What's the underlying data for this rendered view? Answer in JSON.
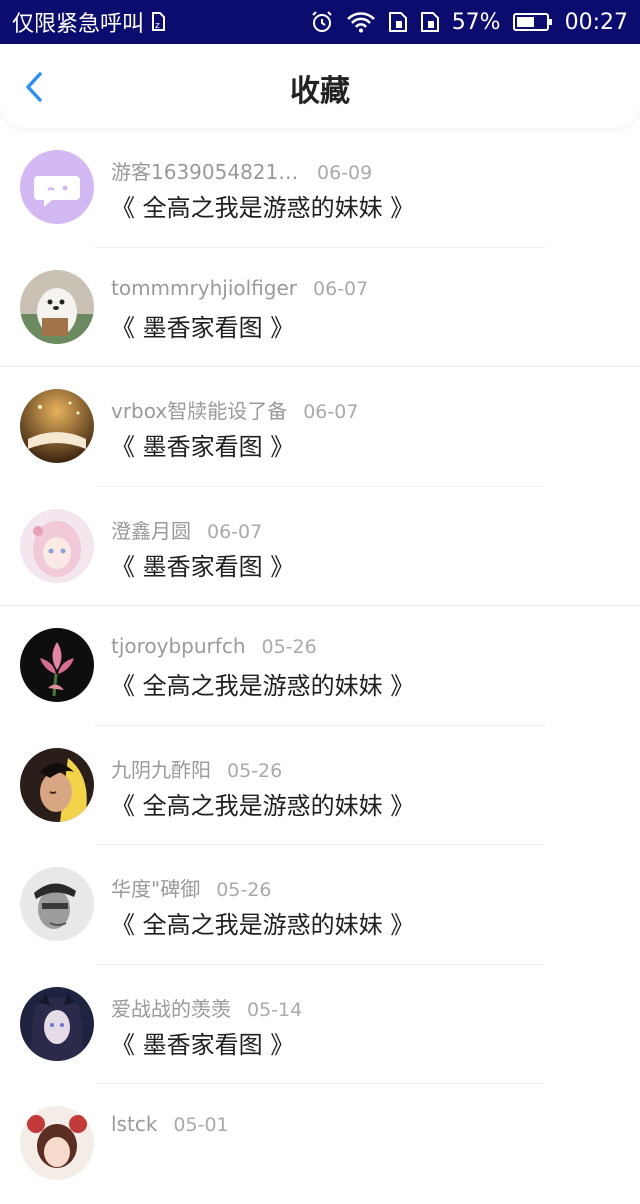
{
  "status_bar": {
    "carrier": "仅限紧急呼叫",
    "battery": "57%",
    "time": "00:27"
  },
  "header": {
    "title": "收藏"
  },
  "items": [
    {
      "name": "游客16390548212...",
      "date": "06-09",
      "book": "《 全高之我是游惑的妹妹 》"
    },
    {
      "name": "tommmryhjiolfiger",
      "date": "06-07",
      "book": "《 墨香家看图 》"
    },
    {
      "name": "vrbox智牍能设了备",
      "date": "06-07",
      "book": "《 墨香家看图 》"
    },
    {
      "name": "澄鑫月圆",
      "date": "06-07",
      "book": "《 墨香家看图 》"
    },
    {
      "name": "tjoroybpurfch",
      "date": "05-26",
      "book": "《 全高之我是游惑的妹妹 》"
    },
    {
      "name": "九阴九酢阳",
      "date": "05-26",
      "book": "《 全高之我是游惑的妹妹 》"
    },
    {
      "name": "华度\"碑御",
      "date": "05-26",
      "book": "《 全高之我是游惑的妹妹 》"
    },
    {
      "name": "爱战战的羡羡",
      "date": "05-14",
      "book": "《 墨香家看图 》"
    },
    {
      "name": "lstck",
      "date": "05-01",
      "book": ""
    }
  ],
  "colors": {
    "status_bar_bg": "#0c0c6e",
    "accent": "#2f8ff0",
    "default_avatar": "#d2b9f3"
  }
}
